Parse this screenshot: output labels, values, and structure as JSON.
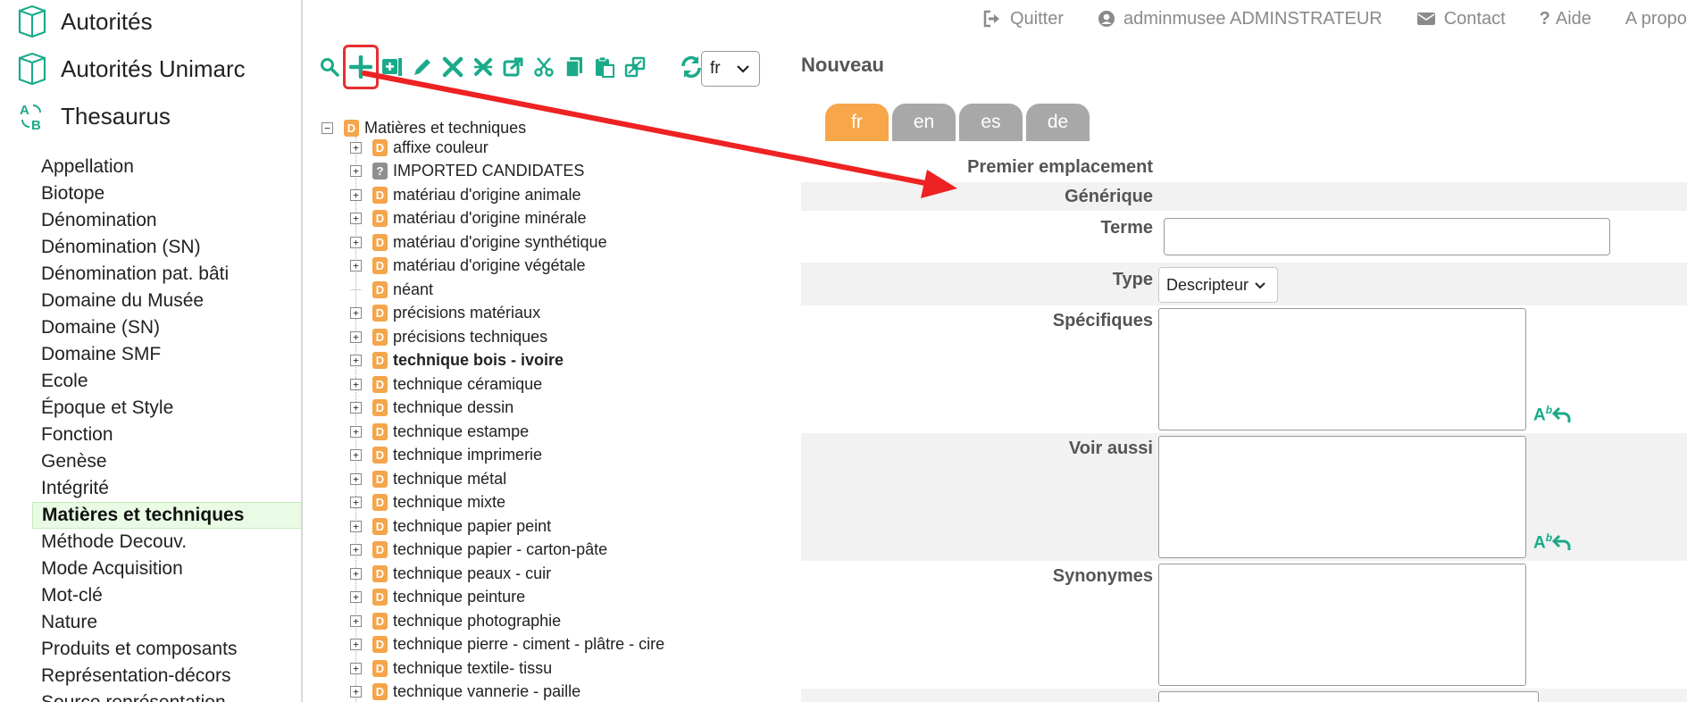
{
  "sidebar": {
    "modules": [
      {
        "label": "Autorités",
        "icon": "book-icon"
      },
      {
        "label": "Autorités Unimarc",
        "icon": "book-icon"
      },
      {
        "label": "Thesaurus",
        "icon": "thesaurus-ab-icon"
      }
    ],
    "thesaurus_items": [
      "Appellation",
      "Biotope",
      "Dénomination",
      "Dénomination (SN)",
      "Dénomination pat. bâti",
      "Domaine du Musée",
      "Domaine (SN)",
      "Domaine SMF",
      "Ecole",
      "Époque et Style",
      "Fonction",
      "Genèse",
      "Intégrité",
      "Matières et techniques",
      "Méthode Decouv.",
      "Mode Acquisition",
      "Mot-clé",
      "Nature",
      "Produits et composants",
      "Représentation-décors",
      "Source représentation"
    ],
    "active_item": "Matières et techniques"
  },
  "topbar": {
    "quit": "Quitter",
    "user": "adminmusee ADMINSTRATEUR",
    "contact": "Contact",
    "help": "Aide",
    "about": "A propos"
  },
  "toolbar": {
    "icons": [
      "search-icon",
      "add-icon",
      "add-child-icon",
      "edit-icon",
      "delete-icon",
      "delete-branch-icon",
      "external-link-icon",
      "cut-icon",
      "copy-icon",
      "paste-icon",
      "merge-icon"
    ],
    "highlighted": "add-icon",
    "language": "fr",
    "accent_color": "#1aaa8a",
    "highlight_color": "#e53030"
  },
  "tree": {
    "root": {
      "label": "Matières et techniques",
      "badge": "D"
    },
    "children": [
      {
        "label": "affixe couleur",
        "badge": "D",
        "expandable": true,
        "bold": false
      },
      {
        "label": "IMPORTED CANDIDATES",
        "badge": "?",
        "expandable": true,
        "bold": false
      },
      {
        "label": "matériau d'origine animale",
        "badge": "D",
        "expandable": true,
        "bold": false
      },
      {
        "label": "matériau d'origine minérale",
        "badge": "D",
        "expandable": true,
        "bold": false
      },
      {
        "label": "matériau d'origine synthétique",
        "badge": "D",
        "expandable": true,
        "bold": false
      },
      {
        "label": "matériau d'origine végétale",
        "badge": "D",
        "expandable": true,
        "bold": false
      },
      {
        "label": "néant",
        "badge": "D",
        "expandable": false,
        "bold": false
      },
      {
        "label": "précisions matériaux",
        "badge": "D",
        "expandable": true,
        "bold": false
      },
      {
        "label": "précisions techniques",
        "badge": "D",
        "expandable": true,
        "bold": false
      },
      {
        "label": "technique bois - ivoire",
        "badge": "D",
        "expandable": true,
        "bold": true
      },
      {
        "label": "technique céramique",
        "badge": "D",
        "expandable": true,
        "bold": false
      },
      {
        "label": "technique dessin",
        "badge": "D",
        "expandable": true,
        "bold": false
      },
      {
        "label": "technique estampe",
        "badge": "D",
        "expandable": true,
        "bold": false
      },
      {
        "label": "technique imprimerie",
        "badge": "D",
        "expandable": true,
        "bold": false
      },
      {
        "label": "technique métal",
        "badge": "D",
        "expandable": true,
        "bold": false
      },
      {
        "label": "technique mixte",
        "badge": "D",
        "expandable": true,
        "bold": false
      },
      {
        "label": "technique papier peint",
        "badge": "D",
        "expandable": true,
        "bold": false
      },
      {
        "label": "technique papier - carton-pâte",
        "badge": "D",
        "expandable": true,
        "bold": false
      },
      {
        "label": "technique peaux - cuir",
        "badge": "D",
        "expandable": true,
        "bold": false
      },
      {
        "label": "technique peinture",
        "badge": "D",
        "expandable": true,
        "bold": false
      },
      {
        "label": "technique photographie",
        "badge": "D",
        "expandable": true,
        "bold": false
      },
      {
        "label": "technique pierre - ciment - plâtre - cire",
        "badge": "D",
        "expandable": true,
        "bold": false
      },
      {
        "label": "technique textile- tissu",
        "badge": "D",
        "expandable": true,
        "bold": false
      },
      {
        "label": "technique vannerie - paille",
        "badge": "D",
        "expandable": true,
        "bold": false
      }
    ]
  },
  "form": {
    "title": "Nouveau",
    "tabs": [
      "fr",
      "en",
      "es",
      "de"
    ],
    "active_tab": "fr",
    "labels": {
      "premier": "Premier emplacement",
      "generique": "Générique",
      "terme": "Terme",
      "type": "Type",
      "specifiques": "Spécifiques",
      "voir_aussi": "Voir aussi",
      "synonymes": "Synonymes"
    },
    "terme_value": "",
    "type_value": "Descripteur"
  }
}
